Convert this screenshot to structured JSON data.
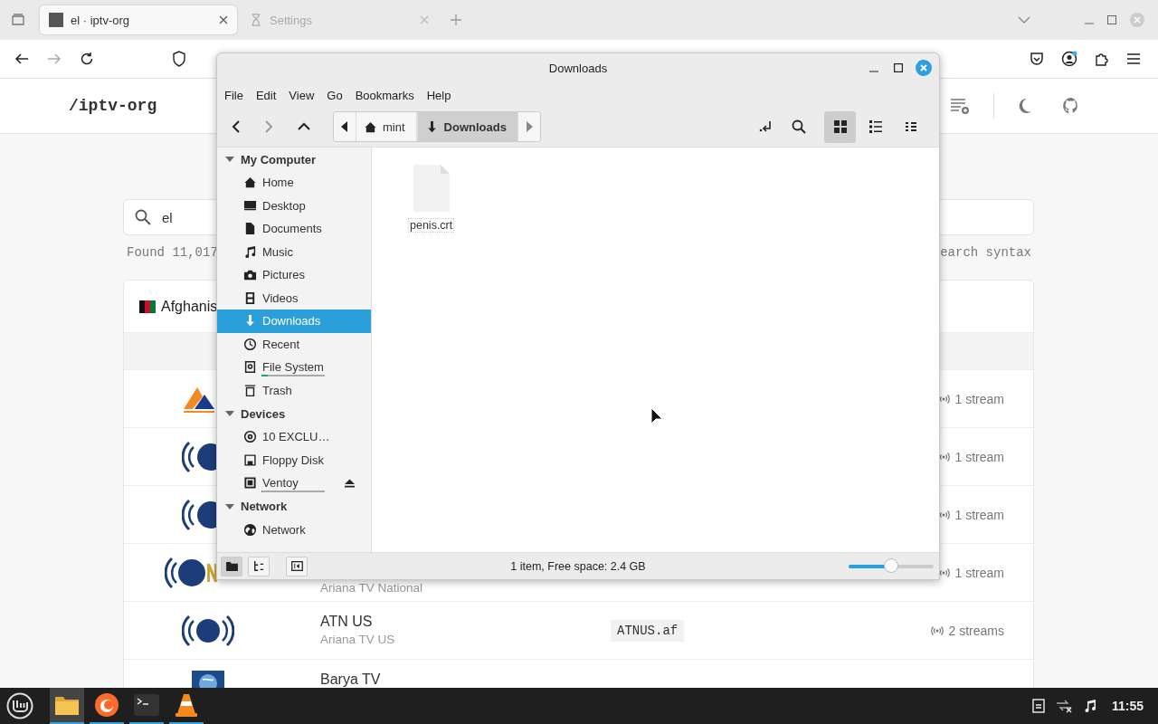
{
  "browser": {
    "tabs": [
      {
        "title": "el · iptv-org",
        "selected": true
      },
      {
        "title": "Settings",
        "selected": false
      }
    ]
  },
  "site": {
    "logo": "/iptv-org",
    "search": {
      "value": "el"
    },
    "found": "Found 11,017",
    "syntax_link": "earch syntax",
    "country": "Afghanis",
    "rows": [
      {
        "kind": "asia",
        "streams": "1 stream"
      },
      {
        "kind": "atn-cut",
        "streams": "1 stream"
      },
      {
        "kind": "atn-cut",
        "streams": "1 stream"
      },
      {
        "kind": "atnn",
        "alt": "Ariana TV National",
        "streams": "1 stream"
      },
      {
        "kind": "atn",
        "name": "ATN US",
        "alt": "Ariana TV US",
        "code": "ATNUS.af",
        "streams": "2 streams"
      },
      {
        "kind": "globe",
        "name": "Barya TV"
      }
    ]
  },
  "file_manager": {
    "title": "Downloads",
    "menu": [
      "File",
      "Edit",
      "View",
      "Go",
      "Bookmarks",
      "Help"
    ],
    "path": [
      {
        "label": "mint",
        "kind": "home",
        "selected": false
      },
      {
        "label": "Downloads",
        "kind": "downloads",
        "selected": true
      }
    ],
    "views": [
      {
        "kind": "grid",
        "selected": true
      },
      {
        "kind": "list",
        "selected": false
      },
      {
        "kind": "compact",
        "selected": false
      }
    ],
    "sections": [
      {
        "title": "My Computer",
        "expanded": true,
        "items": [
          {
            "label": "Home",
            "kind": "home",
            "selected": false
          },
          {
            "label": "Desktop",
            "kind": "desktop",
            "selected": false
          },
          {
            "label": "Documents",
            "kind": "documents",
            "selected": false
          },
          {
            "label": "Music",
            "kind": "music",
            "selected": false
          },
          {
            "label": "Pictures",
            "kind": "pictures",
            "selected": false
          },
          {
            "label": "Videos",
            "kind": "videos",
            "selected": false
          },
          {
            "label": "Downloads",
            "kind": "downloads",
            "selected": true
          },
          {
            "label": "Recent",
            "kind": "recent",
            "selected": false
          },
          {
            "label": "File System",
            "kind": "filesystem",
            "selected": false,
            "level": 0.1
          },
          {
            "label": "Trash",
            "kind": "trash",
            "selected": false
          }
        ]
      },
      {
        "title": "Devices",
        "expanded": true,
        "items": [
          {
            "label": "10 EXCLU…",
            "kind": "disc",
            "selected": false,
            "ejectable": false
          },
          {
            "label": "Floppy Disk",
            "kind": "floppy",
            "selected": false,
            "ejectable": false
          },
          {
            "label": "Ventoy",
            "kind": "usb",
            "selected": false,
            "ejectable": true,
            "level": 0
          }
        ]
      },
      {
        "title": "Network",
        "expanded": true,
        "items": [
          {
            "label": "Network",
            "kind": "network",
            "selected": false
          }
        ]
      }
    ],
    "files": [
      {
        "name": "penis.crt"
      }
    ],
    "status": "1 item, Free space: 2.4 GB",
    "zoom": {
      "level": 0.5
    }
  },
  "taskbar": {
    "apps": [
      {
        "kind": "files",
        "active": true
      },
      {
        "kind": "firefox",
        "active": false
      },
      {
        "kind": "terminal",
        "active": false
      },
      {
        "kind": "vlc",
        "active": false
      }
    ],
    "time": "11:55"
  }
}
